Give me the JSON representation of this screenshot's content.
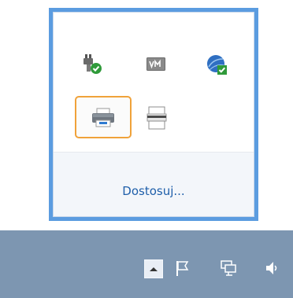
{
  "overflow_popup": {
    "icons": [
      {
        "name": "usb-safely-remove-icon"
      },
      {
        "name": "vmware-tools-icon"
      },
      {
        "name": "network-security-icon"
      },
      {
        "name": "printer-icon"
      },
      {
        "name": "document-printer-icon"
      }
    ],
    "customize_label": "Dostosuj..."
  },
  "taskbar": {
    "icons": [
      {
        "name": "chevron-up-icon"
      },
      {
        "name": "action-center-flag-icon"
      },
      {
        "name": "network-icon"
      },
      {
        "name": "volume-icon"
      }
    ]
  }
}
